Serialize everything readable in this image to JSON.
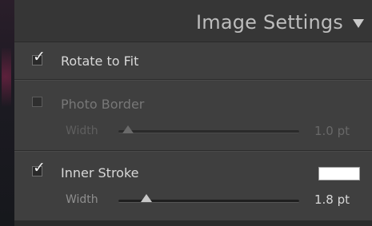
{
  "panel": {
    "title": "Image Settings"
  },
  "rotate_to_fit": {
    "label": "Rotate to Fit",
    "checked": true
  },
  "photo_border": {
    "label": "Photo Border",
    "checked": false,
    "width_label": "Width",
    "width_value": "1.0 pt",
    "slider_level": 0.0
  },
  "inner_stroke": {
    "label": "Inner Stroke",
    "checked": true,
    "color": "#ffffff",
    "width_label": "Width",
    "width_value": "1.8 pt",
    "slider_level": 0.1
  },
  "checkmark_glyph": "✓"
}
